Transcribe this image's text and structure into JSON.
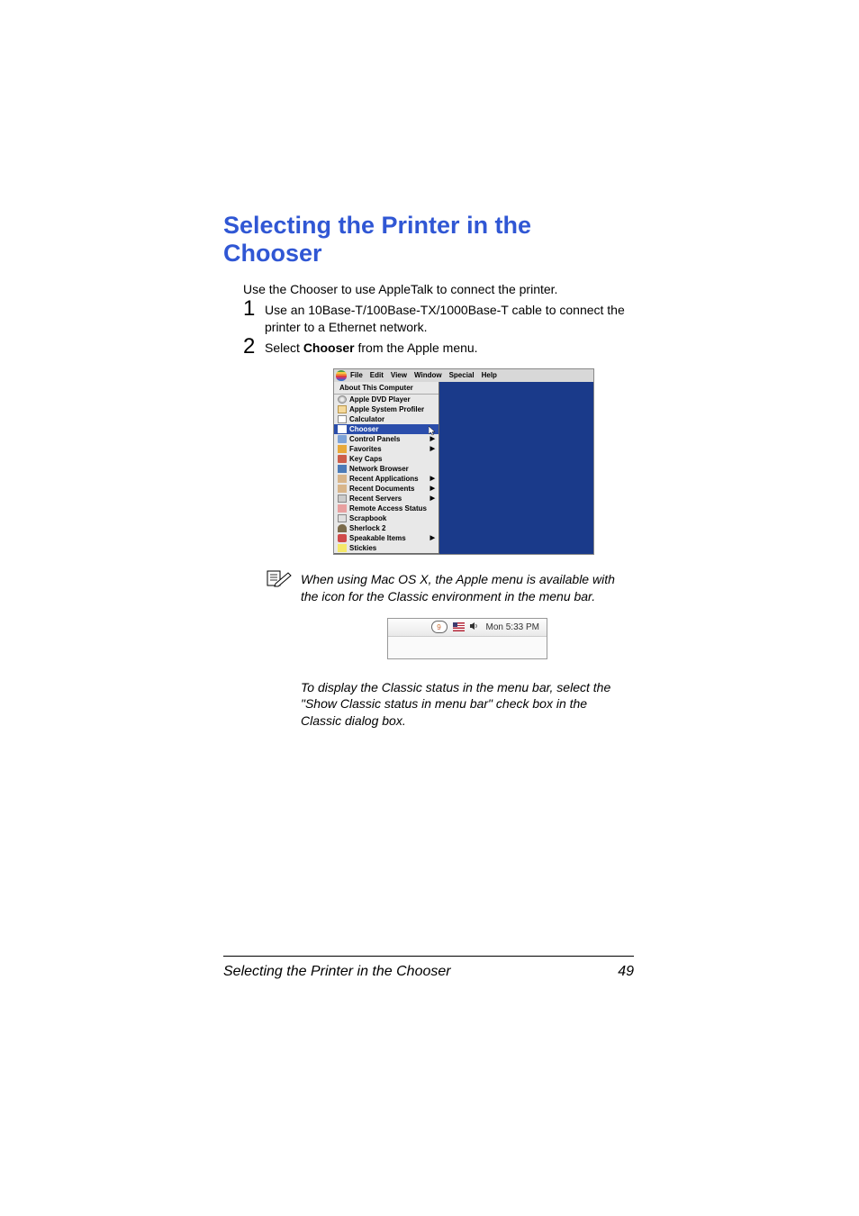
{
  "title": "Selecting the Printer in the Chooser",
  "intro": "Use the Chooser to use AppleTalk to connect the printer.",
  "steps": [
    {
      "num": "1",
      "text": "Use an 10Base-T/100Base-TX/1000Base-T cable to connect the printer to a Ethernet network."
    },
    {
      "num": "2",
      "text_pre": "Select ",
      "text_bold": "Chooser",
      "text_post": " from the Apple menu."
    }
  ],
  "menubar": {
    "items": [
      "File",
      "Edit",
      "View",
      "Window",
      "Special",
      "Help"
    ]
  },
  "dropdown": {
    "header": "About This Computer",
    "items": [
      {
        "label": "Apple DVD Player",
        "icon": "icon-cd"
      },
      {
        "label": "Apple System Profiler",
        "icon": "icon-box"
      },
      {
        "label": "Calculator",
        "icon": "icon-calc"
      },
      {
        "label": "Chooser",
        "icon": "icon-chooser-white",
        "highlight": true,
        "cursor": true
      },
      {
        "label": "Control Panels",
        "icon": "icon-folder",
        "arrow": true
      },
      {
        "label": "Favorites",
        "icon": "icon-star",
        "arrow": true
      },
      {
        "label": "Key Caps",
        "icon": "icon-key"
      },
      {
        "label": "Network Browser",
        "icon": "icon-net"
      },
      {
        "label": "Recent Applications",
        "icon": "icon-doc",
        "arrow": true
      },
      {
        "label": "Recent Documents",
        "icon": "icon-doc",
        "arrow": true
      },
      {
        "label": "Recent Servers",
        "icon": "icon-server",
        "arrow": true
      },
      {
        "label": "Remote Access Status",
        "icon": "icon-remote"
      },
      {
        "label": "Scrapbook",
        "icon": "icon-book"
      },
      {
        "label": "Sherlock 2",
        "icon": "icon-hat"
      },
      {
        "label": "Speakable Items",
        "icon": "icon-lips",
        "arrow": true
      },
      {
        "label": "Stickies",
        "icon": "icon-note"
      }
    ]
  },
  "note1": "When using Mac OS X, the Apple menu is available with the icon for the Classic environment in the menu bar.",
  "menubar2": {
    "time": "Mon 5:33 PM"
  },
  "note2": "To display the Classic status in the menu bar, select the \"Show Classic status in menu bar\" check box in the Classic dialog box.",
  "footer": {
    "title": "Selecting the Printer in the Chooser",
    "page": "49"
  }
}
